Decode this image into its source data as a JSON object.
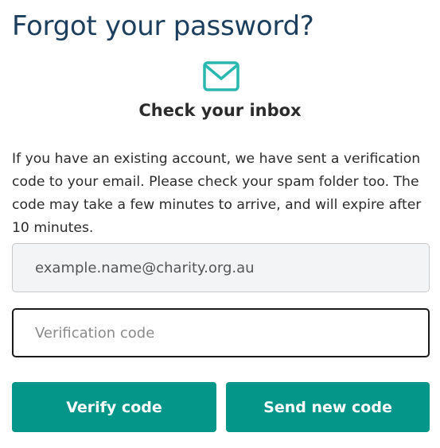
{
  "page": {
    "title": "Forgot your password?",
    "icon": "envelope-icon",
    "subheading": "Check your inbox",
    "message": "If you have an existing account, we have sent a verification code to your email. Please check your spam folder too. The code may take a few minutes to arrive, and will expire after 10 minutes."
  },
  "form": {
    "email_value": "example.name@charity.org.au",
    "code_value": "",
    "code_placeholder": "Verification code"
  },
  "buttons": {
    "verify_label": "Verify code",
    "send_new_label": "Send new code"
  },
  "colors": {
    "accent": "#05968a",
    "title": "#1c3f5e",
    "icon": "#2ab7b0"
  }
}
